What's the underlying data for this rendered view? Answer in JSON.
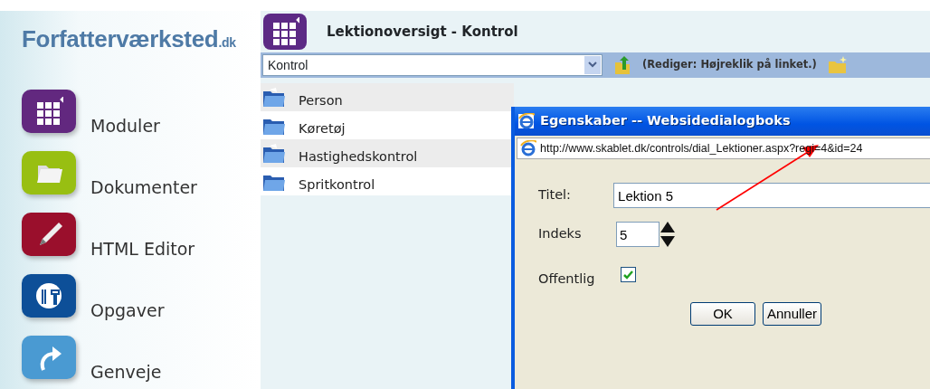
{
  "sidebar": {
    "logo": {
      "name": "Forfatterværksted",
      "suffix": ".dk"
    },
    "items": [
      {
        "label": "Moduler",
        "kind": "modules"
      },
      {
        "label": "Dokumenter",
        "kind": "documents"
      },
      {
        "label": "HTML Editor",
        "kind": "editor"
      },
      {
        "label": "Opgaver",
        "kind": "tasks"
      },
      {
        "label": "Genveje",
        "kind": "shortcuts"
      }
    ]
  },
  "header": {
    "title": "Lektionoversigt - Kontrol"
  },
  "toolbar": {
    "select_value": "Kontrol",
    "hint": "(Rediger: Højreklik på linket.)"
  },
  "folders": [
    {
      "label": "Person"
    },
    {
      "label": "Køretøj"
    },
    {
      "label": "Hastighedskontrol"
    },
    {
      "label": "Spritkontrol"
    }
  ],
  "dialog": {
    "title": "Egenskaber -- Websidedialogboks",
    "address": "http://www.skablet.dk/controls/dial_Lektioner.aspx?regi=4&id=24",
    "fields": [
      {
        "kind": "text",
        "label": "Titel:",
        "value": "Lektion 5"
      },
      {
        "kind": "spinner",
        "label": "Indeks",
        "value": "5"
      },
      {
        "kind": "checkbox",
        "label": "Offentlig",
        "checked": true
      }
    ],
    "buttons": [
      "OK",
      "Annuller"
    ]
  }
}
